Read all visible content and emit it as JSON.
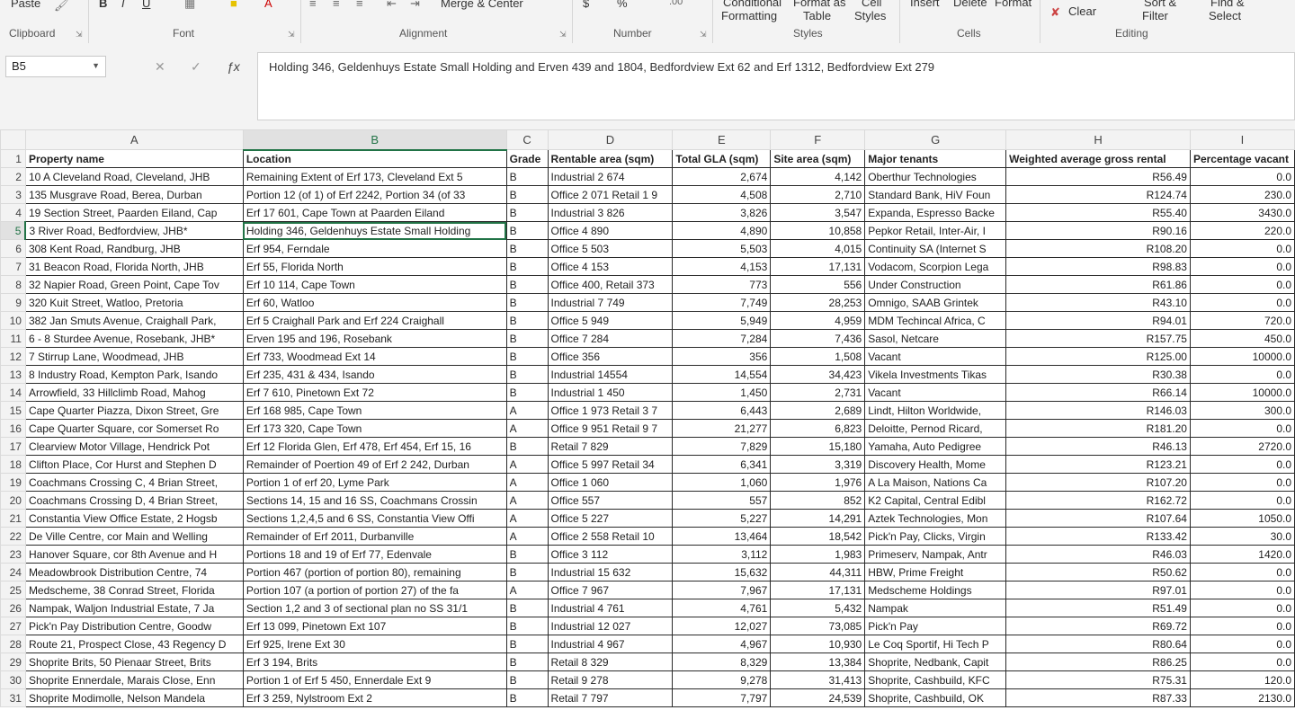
{
  "ribbon": {
    "top_texts": [
      "Paste",
      "B",
      "I",
      "U",
      "Merge & Center",
      "$",
      "%",
      "Conditional",
      "Format as",
      "Cell",
      "Insert",
      "Delete",
      "Format",
      "Sort &",
      "Find &"
    ],
    "clipboard": "Clipboard",
    "font": "Font",
    "alignment": "Alignment",
    "number": "Number",
    "styles": "Styles",
    "cells": "Cells",
    "editing": "Editing",
    "conditional_formatting": "Formatting",
    "format_as_table": "Table",
    "cell_styles": "Styles",
    "clear": "Clear",
    "sort_filter": "Filter",
    "find_select": "Select",
    "accent": "#217346"
  },
  "name_box": "B5",
  "formula": "Holding 346, Geldenhuys Estate Small Holding and Erven 439 and 1804, Bedfordview Ext 62 and Erf 1312, Bedfordview Ext 279",
  "columns": [
    "A",
    "B",
    "C",
    "D",
    "E",
    "F",
    "G",
    "H",
    "I"
  ],
  "rows": [
    {
      "n": "1",
      "c": [
        "Property name",
        "Location",
        "Grade",
        "Rentable area (sqm)",
        "Total GLA (sqm)",
        "Site area (sqm)",
        "Major tenants",
        "Weighted average gross rental",
        "Percentage vacant"
      ]
    },
    {
      "n": "2",
      "c": [
        "10 A Cleveland Road, Cleveland, JHB",
        "Remaining Extent of Erf 173, Cleveland Ext 5",
        "B",
        "Industrial 2 674",
        "2,674",
        "4,142",
        "Oberthur Technologies",
        "R56.49",
        "0.0"
      ]
    },
    {
      "n": "3",
      "c": [
        "135 Musgrave Road, Berea, Durban",
        "Portion 12 (of 1) of Erf 2242, Portion 34 (of 33",
        "B",
        "Office 2 071 Retail 1 9",
        "4,508",
        "2,710",
        "Standard Bank, HiV Foun",
        "R124.74",
        "230.0"
      ]
    },
    {
      "n": "4",
      "c": [
        "19 Section Street, Paarden Eiland, Cap",
        "Erf 17 601, Cape Town at Paarden Eiland",
        "B",
        "Industrial 3 826",
        "3,826",
        "3,547",
        "Expanda, Espresso Backe",
        "R55.40",
        "3430.0"
      ]
    },
    {
      "n": "5",
      "c": [
        "3 River Road, Bedfordview, JHB*",
        "Holding 346, Geldenhuys Estate Small Holding",
        "B",
        "Office 4 890",
        "4,890",
        "10,858",
        "Pepkor Retail, Inter-Air, I",
        "R90.16",
        "220.0"
      ]
    },
    {
      "n": "6",
      "c": [
        "308 Kent Road, Randburg, JHB",
        "Erf 954, Ferndale",
        "B",
        "Office 5 503",
        "5,503",
        "4,015",
        "Continuity SA (Internet S",
        "R108.20",
        "0.0"
      ]
    },
    {
      "n": "7",
      "c": [
        "31 Beacon Road, Florida North, JHB",
        "Erf 55, Florida North",
        "B",
        "Office 4 153",
        "4,153",
        "17,131",
        "Vodacom, Scorpion Lega",
        "R98.83",
        "0.0"
      ]
    },
    {
      "n": "8",
      "c": [
        "32 Napier Road, Green Point, Cape Tov",
        "Erf 10 114, Cape Town",
        "B",
        "Office 400, Retail 373",
        "773",
        "556",
        "Under Construction",
        "R61.86",
        "0.0"
      ]
    },
    {
      "n": "9",
      "c": [
        "320 Kuit Street, Watloo, Pretoria",
        "Erf 60, Watloo",
        "B",
        "Industrial 7 749",
        "7,749",
        "28,253",
        "Omnigo, SAAB Grintek",
        "R43.10",
        "0.0"
      ]
    },
    {
      "n": "10",
      "c": [
        "382 Jan Smuts Avenue, Craighall Park,",
        "Erf 5 Craighall Park and Erf 224 Craighall",
        "B",
        "Office 5 949",
        "5,949",
        "4,959",
        "MDM Techincal Africa, C",
        "R94.01",
        "720.0"
      ]
    },
    {
      "n": "11",
      "c": [
        "6 - 8 Sturdee Avenue, Rosebank, JHB*",
        "Erven 195 and 196, Rosebank",
        "B",
        "Office 7 284",
        "7,284",
        "7,436",
        "Sasol, Netcare",
        "R157.75",
        "450.0"
      ]
    },
    {
      "n": "12",
      "c": [
        "7 Stirrup Lane, Woodmead, JHB",
        "Erf 733, Woodmead Ext 14",
        "B",
        "Office 356",
        "356",
        "1,508",
        "Vacant",
        "R125.00",
        "10000.0"
      ]
    },
    {
      "n": "13",
      "c": [
        "8 Industry Road, Kempton Park, Isando",
        "Erf 235, 431 & 434, Isando",
        "B",
        "Industrial 14554",
        "14,554",
        "34,423",
        "Vikela Investments Tikas",
        "R30.38",
        "0.0"
      ]
    },
    {
      "n": "14",
      "c": [
        "Arrowfield, 33 Hillclimb Road, Mahog",
        "Erf 7 610, Pinetown Ext 72",
        "B",
        "Industrial 1 450",
        "1,450",
        "2,731",
        "Vacant",
        "R66.14",
        "10000.0"
      ]
    },
    {
      "n": "15",
      "c": [
        "Cape Quarter Piazza, Dixon Street, Gre",
        "Erf 168 985, Cape Town",
        "A",
        "Office 1 973 Retail 3 7",
        "6,443",
        "2,689",
        "Lindt, Hilton Worldwide,",
        "R146.03",
        "300.0"
      ]
    },
    {
      "n": "16",
      "c": [
        "Cape Quarter Square, cor Somerset Ro",
        "Erf 173 320, Cape Town",
        "A",
        "Office 9 951 Retail 9 7",
        "21,277",
        "6,823",
        "Deloitte, Pernod Ricard,",
        "R181.20",
        "0.0"
      ]
    },
    {
      "n": "17",
      "c": [
        "Clearview Motor Village, Hendrick Pot",
        "Erf 12 Florida Glen, Erf 478, Erf 454, Erf 15, 16",
        "B",
        "Retail 7 829",
        "7,829",
        "15,180",
        "Yamaha, Auto Pedigree",
        "R46.13",
        "2720.0"
      ]
    },
    {
      "n": "18",
      "c": [
        "Clifton Place, Cor Hurst and Stephen D",
        "Remainder of Poertion 49 of Erf 2 242, Durban",
        "A",
        "Office 5 997 Retail 34",
        "6,341",
        "3,319",
        "Discovery Health, Mome",
        "R123.21",
        "0.0"
      ]
    },
    {
      "n": "19",
      "c": [
        "Coachmans Crossing C, 4 Brian Street,",
        "Portion 1 of erf 20, Lyme Park",
        "A",
        "Office 1 060",
        "1,060",
        "1,976",
        "A La Maison, Nations Ca",
        "R107.20",
        "0.0"
      ]
    },
    {
      "n": "20",
      "c": [
        "Coachmans Crossing D, 4 Brian Street,",
        "Sections 14, 15 and 16 SS, Coachmans Crossin",
        "A",
        "Office 557",
        "557",
        "852",
        "K2 Capital, Central Edibl",
        "R162.72",
        "0.0"
      ]
    },
    {
      "n": "21",
      "c": [
        "Constantia View Office Estate, 2 Hogsb",
        "Sections 1,2,4,5 and 6 SS, Constantia View Offi",
        "A",
        "Office 5 227",
        "5,227",
        "14,291",
        "Aztek Technologies, Mon",
        "R107.64",
        "1050.0"
      ]
    },
    {
      "n": "22",
      "c": [
        "De Ville Centre, cor Main and Welling",
        "Remainder of Erf 2011, Durbanville",
        "A",
        "Office 2 558 Retail 10",
        "13,464",
        "18,542",
        "Pick'n Pay, Clicks, Virgin",
        "R133.42",
        "30.0"
      ]
    },
    {
      "n": "23",
      "c": [
        "Hanover Square, cor 8th Avenue and H",
        "Portions 18 and 19 of Erf 77, Edenvale",
        "B",
        "Office 3 112",
        "3,112",
        "1,983",
        "Primeserv, Nampak, Antr",
        "R46.03",
        "1420.0"
      ]
    },
    {
      "n": "24",
      "c": [
        "Meadowbrook Distribution Centre, 74",
        "Portion 467 (portion of portion 80), remaining",
        "B",
        "Industrial 15 632",
        "15,632",
        "44,311",
        "HBW, Prime Freight",
        "R50.62",
        "0.0"
      ]
    },
    {
      "n": "25",
      "c": [
        "Medscheme, 38 Conrad Street, Florida",
        "Portion 107 (a portion of portion 27) of the fa",
        "A",
        "Office 7 967",
        "7,967",
        "17,131",
        "Medscheme Holdings",
        "R97.01",
        "0.0"
      ]
    },
    {
      "n": "26",
      "c": [
        "Nampak, Waljon Industrial Estate, 7 Ja",
        "Section 1,2 and 3 of sectional plan no SS 31/1",
        "B",
        "Industrial 4 761",
        "4,761",
        "5,432",
        "Nampak",
        "R51.49",
        "0.0"
      ]
    },
    {
      "n": "27",
      "c": [
        "Pick'n Pay Distribution Centre, Goodw",
        "Erf 13 099, Pinetown Ext 107",
        "B",
        "Industrial 12 027",
        "12,027",
        "73,085",
        "Pick'n Pay",
        "R69.72",
        "0.0"
      ]
    },
    {
      "n": "28",
      "c": [
        "Route 21, Prospect Close, 43 Regency D",
        "Erf 925, Irene Ext 30",
        "B",
        "Industrial 4 967",
        "4,967",
        "10,930",
        "Le Coq Sportif, Hi Tech P",
        "R80.64",
        "0.0"
      ]
    },
    {
      "n": "29",
      "c": [
        "Shoprite Brits, 50 Pienaar Street, Brits",
        "Erf 3 194, Brits",
        "B",
        "Retail 8 329",
        "8,329",
        "13,384",
        "Shoprite, Nedbank, Capit",
        "R86.25",
        "0.0"
      ]
    },
    {
      "n": "30",
      "c": [
        "Shoprite Ennerdale, Marais Close, Enn",
        "Portion 1 of Erf 5 450, Ennerdale Ext 9",
        "B",
        "Retail 9 278",
        "9,278",
        "31,413",
        "Shoprite, Cashbuild, KFC",
        "R75.31",
        "120.0"
      ]
    },
    {
      "n": "31",
      "c": [
        "Shoprite Modimolle, Nelson Mandela",
        "Erf 3 259, Nylstroom Ext 2",
        "B",
        "Retail 7 797",
        "7,797",
        "24,539",
        "Shoprite, Cashbuild, OK",
        "R87.33",
        "2130.0"
      ]
    }
  ]
}
